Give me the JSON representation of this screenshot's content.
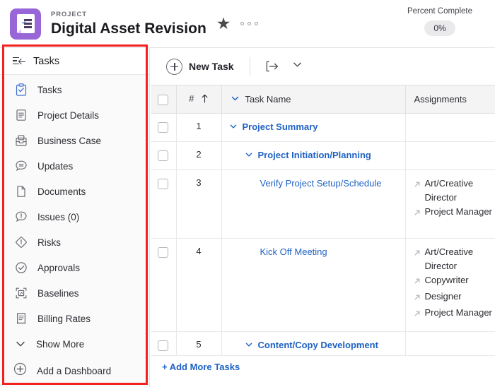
{
  "header": {
    "eyebrow": "PROJECT",
    "title": "Digital Asset Revision",
    "app_icon": "project-document-icon",
    "favorite_icon": "star-icon",
    "more_icon": "more-options-icon",
    "percent_complete_label": "Percent Complete",
    "percent_complete_value": "0%"
  },
  "sidebar": {
    "header_label": "Tasks",
    "collapse_icon": "collapse-sidebar-icon",
    "items": [
      {
        "label": "Tasks",
        "icon": "clipboard-check-icon",
        "active": true
      },
      {
        "label": "Project Details",
        "icon": "document-lines-icon",
        "active": false
      },
      {
        "label": "Business Case",
        "icon": "briefcase-case-icon",
        "active": false
      },
      {
        "label": "Updates",
        "icon": "comment-lines-icon",
        "active": false
      },
      {
        "label": "Documents",
        "icon": "page-icon",
        "active": false
      },
      {
        "label": "Issues (0)",
        "icon": "comment-alert-icon",
        "active": false
      },
      {
        "label": "Risks",
        "icon": "diamond-alert-icon",
        "active": false
      },
      {
        "label": "Approvals",
        "icon": "circle-check-icon",
        "active": false
      },
      {
        "label": "Baselines",
        "icon": "baseline-frame-icon",
        "active": false
      },
      {
        "label": "Billing Rates",
        "icon": "receipt-icon",
        "active": false
      }
    ],
    "show_more": {
      "label": "Show More",
      "icon": "chevron-down-icon"
    },
    "add_dashboard": {
      "label": "Add a Dashboard",
      "icon": "circle-plus-icon"
    },
    "highlight_color": "#f42020"
  },
  "toolbar": {
    "new_task_label": "New Task",
    "new_task_icon": "circle-plus-icon",
    "export_icon": "export-arrow-icon",
    "export_chevron_icon": "chevron-down-icon"
  },
  "table": {
    "columns": [
      {
        "key": "select",
        "label": "",
        "icon": "checkbox-icon"
      },
      {
        "key": "num",
        "label": "#",
        "sort_icon": "sort-ascending-icon"
      },
      {
        "key": "name",
        "label": "Task Name",
        "collapse_icon": "chevron-down-icon"
      },
      {
        "key": "assignments",
        "label": "Assignments"
      }
    ],
    "rows": [
      {
        "num": "1",
        "name": "Project Summary",
        "indent": 0,
        "expandable": true,
        "assignments": []
      },
      {
        "num": "2",
        "name": "Project Initiation/Planning",
        "indent": 1,
        "expandable": true,
        "assignments": []
      },
      {
        "num": "3",
        "name": "Verify Project Setup/Schedule",
        "indent": 2,
        "expandable": false,
        "assignments": [
          "Art/Creative Director",
          "Project Manager"
        ]
      },
      {
        "num": "4",
        "name": "Kick Off Meeting",
        "indent": 2,
        "expandable": false,
        "assignments": [
          "Art/Creative Director",
          "Copywriter",
          "Designer",
          "Project Manager"
        ]
      },
      {
        "num": "5",
        "name": "Content/Copy Development",
        "indent": 1,
        "expandable": true,
        "assignments": []
      }
    ],
    "add_more_label": "+ Add More Tasks",
    "assignment_icon": "assignment-arrow-icon",
    "link_color": "#1f62c4"
  }
}
